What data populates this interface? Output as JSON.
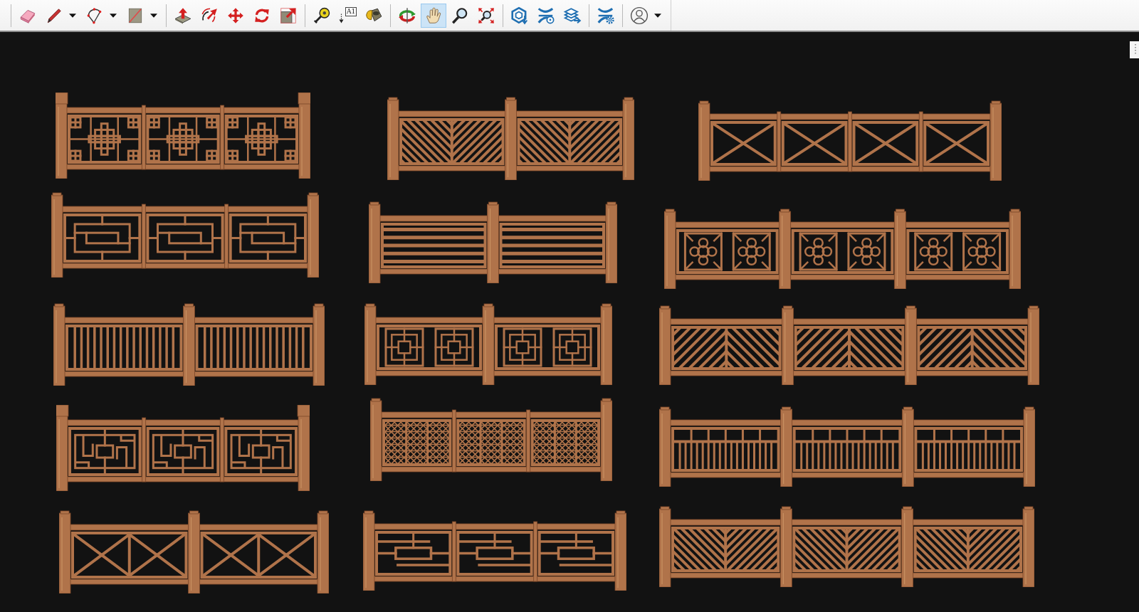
{
  "toolbar": {
    "groups": [
      {
        "tools": [
          {
            "kind": "eraser",
            "selected": false,
            "menu": false
          },
          {
            "kind": "pencil",
            "selected": false,
            "menu": true
          },
          {
            "kind": "arc",
            "selected": false,
            "menu": true
          },
          {
            "kind": "rectangle",
            "selected": false,
            "menu": true
          }
        ]
      },
      {
        "tools": [
          {
            "kind": "push-pull",
            "selected": false,
            "menu": false
          },
          {
            "kind": "offset",
            "selected": false,
            "menu": false
          },
          {
            "kind": "move",
            "selected": false,
            "menu": false
          },
          {
            "kind": "rotate",
            "selected": false,
            "menu": false
          },
          {
            "kind": "scale",
            "selected": false,
            "menu": false
          }
        ]
      },
      {
        "tools": [
          {
            "kind": "tape",
            "selected": false,
            "menu": false
          },
          {
            "kind": "text",
            "selected": false,
            "menu": false,
            "label": "A1"
          },
          {
            "kind": "paint",
            "selected": false,
            "menu": false
          }
        ]
      },
      {
        "tools": [
          {
            "kind": "orbit",
            "selected": false,
            "menu": false
          },
          {
            "kind": "pan",
            "selected": true,
            "menu": false
          },
          {
            "kind": "zoom",
            "selected": false,
            "menu": false
          },
          {
            "kind": "zoom-extents",
            "selected": false,
            "menu": false
          }
        ]
      },
      {
        "tools": [
          {
            "kind": "warehouse",
            "selected": false,
            "menu": false
          },
          {
            "kind": "extensions",
            "selected": false,
            "menu": false
          },
          {
            "kind": "layers",
            "selected": false,
            "menu": false
          }
        ]
      },
      {
        "tools": [
          {
            "kind": "extension-manager",
            "selected": false,
            "menu": false
          }
        ]
      },
      {
        "tools": [
          {
            "kind": "account",
            "selected": false,
            "menu": true
          }
        ]
      }
    ]
  },
  "viewport": {
    "models": [
      {
        "capped": true,
        "post_dividers": false,
        "sections": [
          {
            "kind": "fret-square"
          },
          {
            "kind": "fret-square"
          },
          {
            "kind": "fret-square"
          }
        ]
      },
      {
        "capped": false,
        "post_dividers": true,
        "sections": [
          {
            "kind": "herringbone"
          },
          {
            "kind": "herringbone"
          }
        ]
      },
      {
        "capped": false,
        "post_dividers": false,
        "sections": [
          {
            "kind": "cross"
          },
          {
            "kind": "cross"
          },
          {
            "kind": "cross"
          },
          {
            "kind": "cross"
          }
        ]
      },
      {
        "capped": false,
        "post_dividers": false,
        "sections": [
          {
            "kind": "fret-rect"
          },
          {
            "kind": "fret-rect"
          },
          {
            "kind": "fret-rect"
          }
        ]
      },
      {
        "capped": false,
        "post_dividers": true,
        "sections": [
          {
            "kind": "horizontal"
          },
          {
            "kind": "horizontal"
          }
        ]
      },
      {
        "capped": false,
        "post_dividers": true,
        "sections": [
          {
            "kind": "quatrefoil"
          },
          {
            "kind": "quatrefoil"
          },
          {
            "kind": "quatrefoil"
          }
        ]
      },
      {
        "capped": false,
        "post_dividers": true,
        "sections": [
          {
            "kind": "balusters"
          },
          {
            "kind": "balusters"
          }
        ]
      },
      {
        "capped": false,
        "post_dividers": true,
        "sections": [
          {
            "kind": "medallion"
          },
          {
            "kind": "medallion"
          }
        ]
      },
      {
        "capped": false,
        "post_dividers": true,
        "sections": [
          {
            "kind": "chevron"
          },
          {
            "kind": "chevron"
          },
          {
            "kind": "chevron"
          }
        ]
      },
      {
        "capped": true,
        "post_dividers": false,
        "sections": [
          {
            "kind": "fret-scroll"
          },
          {
            "kind": "fret-scroll"
          },
          {
            "kind": "fret-scroll"
          }
        ]
      },
      {
        "capped": false,
        "post_dividers": false,
        "sections": [
          {
            "kind": "mesh"
          },
          {
            "kind": "mesh"
          },
          {
            "kind": "mesh"
          }
        ]
      },
      {
        "capped": false,
        "post_dividers": true,
        "sections": [
          {
            "kind": "baluster-rail"
          },
          {
            "kind": "baluster-rail"
          },
          {
            "kind": "baluster-rail"
          }
        ]
      },
      {
        "capped": false,
        "post_dividers": true,
        "sections": [
          {
            "kind": "double-cross"
          },
          {
            "kind": "double-cross"
          }
        ]
      },
      {
        "capped": false,
        "post_dividers": false,
        "sections": [
          {
            "kind": "fret-bars"
          },
          {
            "kind": "fret-bars"
          },
          {
            "kind": "fret-bars"
          }
        ]
      },
      {
        "capped": false,
        "post_dividers": true,
        "sections": [
          {
            "kind": "herringbone"
          },
          {
            "kind": "herringbone"
          },
          {
            "kind": "herringbone"
          }
        ]
      }
    ]
  }
}
